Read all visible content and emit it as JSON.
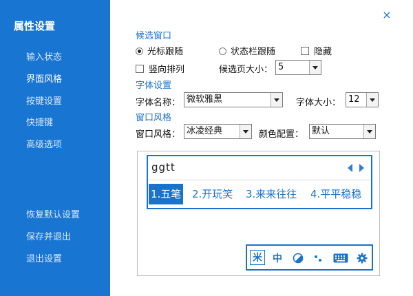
{
  "sidebar": {
    "title": "属性设置",
    "items": [
      {
        "label": "输入状态"
      },
      {
        "label": "界面风格"
      },
      {
        "label": "按键设置"
      },
      {
        "label": "快捷键"
      },
      {
        "label": "高级选项"
      }
    ],
    "actions": [
      {
        "label": "恢复默认设置"
      },
      {
        "label": "保存并退出"
      },
      {
        "label": "退出设置"
      }
    ]
  },
  "window": {
    "close_symbol": "×"
  },
  "candidate_window": {
    "section_title": "候选窗口",
    "follow_cursor": "光标跟随",
    "follow_statusbar": "状态栏跟随",
    "hide": "隐藏",
    "vertical": "竖向排列",
    "page_size_label": "候选页大小：",
    "page_size_value": "5"
  },
  "font": {
    "section_title": "字体设置",
    "name_label": "字体名称：",
    "name_value": "微软雅黑",
    "size_label": "字体大小：",
    "size_value": "12"
  },
  "style": {
    "section_title": "窗口风格",
    "style_label": "窗口风格：",
    "style_value": "冰凌经典",
    "color_label": "颜色配置：",
    "color_value": "默认"
  },
  "preview": {
    "pinyin": "ggtt",
    "candidates": [
      "1.五笔",
      "2.开玩笑",
      "3.来来往往",
      "4.平平稳稳"
    ],
    "toolbar_icons": [
      "chinese-mode-icon",
      "full-width-icon",
      "skin-icon",
      "punctuation-icon",
      "keyboard-icon",
      "settings-icon"
    ],
    "toolbar_glyphs": {
      "chinese_mode": "米",
      "full_width": "中"
    }
  },
  "colors": {
    "accent": "#1a73c9",
    "sidebar": "#1875d1"
  }
}
